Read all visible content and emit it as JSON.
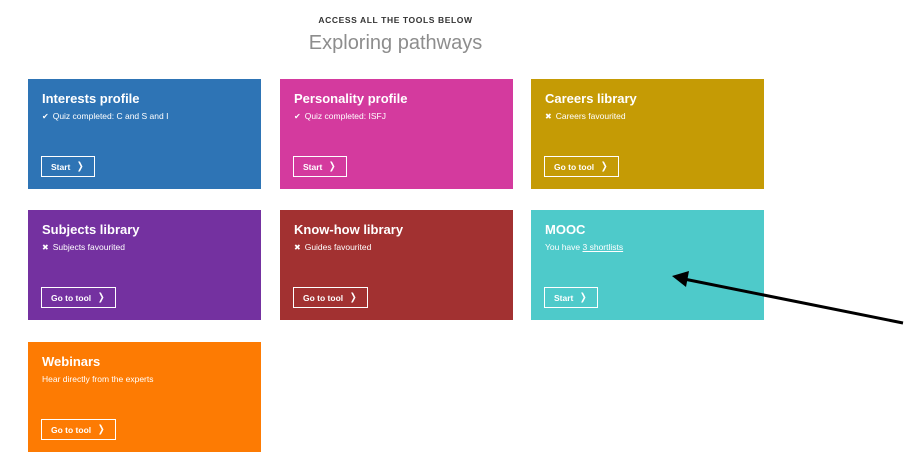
{
  "header": {
    "eyebrow": "ACCESS ALL THE TOOLS BELOW",
    "title": "Exploring pathways"
  },
  "cards": [
    {
      "title": "Interests profile",
      "mark": "check-icon",
      "status": "Quiz completed: C and S and I",
      "button": "Start",
      "color": "#2e74b5"
    },
    {
      "title": "Personality profile",
      "mark": "check-icon",
      "status": "Quiz completed: ISFJ",
      "button": "Start",
      "color": "#d43a9e"
    },
    {
      "title": "Careers library",
      "mark": "cross-icon",
      "status": "Careers favourited",
      "button": "Go to tool",
      "color": "#c59b05"
    },
    {
      "title": "Subjects library",
      "mark": "cross-icon",
      "status": "Subjects favourited",
      "button": "Go to tool",
      "color": "#7431a0"
    },
    {
      "title": "Know-how library",
      "mark": "cross-icon",
      "status": "Guides favourited",
      "button": "Go to tool",
      "color": "#a23131"
    },
    {
      "title": "MOOC",
      "status_prefix": "You have ",
      "status_link": "3 shortlists",
      "button": "Start",
      "color": "#4ecaca"
    },
    {
      "title": "Webinars",
      "status": "Hear directly from the experts",
      "button": "Go to tool",
      "color": "#fd7b03"
    }
  ],
  "icons": {
    "check": "✔",
    "cross": "✖",
    "chevron": "❯"
  },
  "annotation": {
    "type": "arrow",
    "color": "#000000",
    "points_to": "MOOC card"
  }
}
